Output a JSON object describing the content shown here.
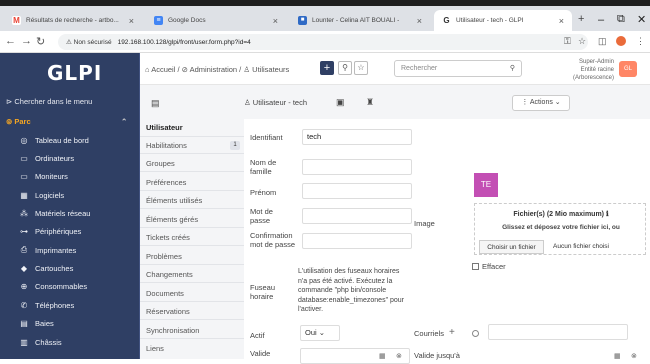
{
  "browser": {
    "tabs": [
      {
        "label": "Résultats de recherche - artbo...",
        "fav_color": "#ea4335",
        "fav_letter": "M"
      },
      {
        "label": "Google Docs",
        "fav_color": "#4285f4",
        "fav_letter": "≡"
      },
      {
        "label": "Lounter - Celina AIT BOUALI -",
        "fav_color": "#2f6ac5",
        "fav_letter": "■"
      },
      {
        "label": "Utilisateur - tech - GLPI",
        "fav_color": "#333",
        "fav_letter": "G"
      }
    ],
    "security": "Non sécurisé",
    "url": "192.168.100.128/glpi/front/user.form.php?id=4"
  },
  "sidebar": {
    "logo": "GLPI",
    "search": "Chercher dans le menu",
    "section": "Parc",
    "items": [
      {
        "label": "Tableau de bord",
        "icon": "dashboard-icon",
        "glyph": "◎"
      },
      {
        "label": "Ordinateurs",
        "icon": "computer-icon",
        "glyph": "▭"
      },
      {
        "label": "Moniteurs",
        "icon": "monitor-icon",
        "glyph": "▭"
      },
      {
        "label": "Logiciels",
        "icon": "software-icon",
        "glyph": "▦"
      },
      {
        "label": "Matériels réseau",
        "icon": "network-icon",
        "glyph": "⁂"
      },
      {
        "label": "Périphériques",
        "icon": "device-icon",
        "glyph": "⊶"
      },
      {
        "label": "Imprimantes",
        "icon": "printer-icon",
        "glyph": "⎙"
      },
      {
        "label": "Cartouches",
        "icon": "cartridge-icon",
        "glyph": "◆"
      },
      {
        "label": "Consommables",
        "icon": "consumable-icon",
        "glyph": "⊕"
      },
      {
        "label": "Téléphones",
        "icon": "phone-icon",
        "glyph": "✆"
      },
      {
        "label": "Baies",
        "icon": "rack-icon",
        "glyph": "▤"
      },
      {
        "label": "Châssis",
        "icon": "chassis-icon",
        "glyph": "▥"
      }
    ]
  },
  "header": {
    "breadcrumb": "⌂ Accueil / ⊘ Administration / ♙ Utilisateurs",
    "search_placeholder": "Rechercher",
    "user_name": "Super-Admin",
    "entity": "Entité racine (Arborescence)",
    "avatar": "GL"
  },
  "card": {
    "title": "♙ Utilisateur - tech",
    "actions": "⋮ Actions ⌄"
  },
  "vtabs": [
    "Utilisateur",
    "Habilitations",
    "Groupes",
    "Préférences",
    "Éléments utilisés",
    "Éléments gérés",
    "Tickets créés",
    "Problèmes",
    "Changements",
    "Documents",
    "Réservations",
    "Synchronisation",
    "Liens"
  ],
  "habilitations_count": "1",
  "form": {
    "identifiant_label": "Identifiant",
    "identifiant_value": "tech",
    "nom_label": "Nom de famille",
    "prenom_label": "Prénom",
    "mdp_label": "Mot de passe",
    "confirm_label": "Confirmation mot de passe",
    "fuseau_label": "Fuseau horaire",
    "tz_note": "L'utilisation des fuseaux horaires n'a pas été activé. Exécutez la commande \"php bin/console database:enable_timezones\" pour l'activer.",
    "actif_label": "Actif",
    "actif_value": "Oui",
    "valide_label": "Valide",
    "image_label": "Image",
    "avatar_initials": "TE",
    "upload_title": "Fichier(s) (2 Mio maximum) ℹ",
    "upload_hint": "Glissez et déposez votre fichier ici, ou",
    "choose_file": "Choisir un fichier",
    "no_file": "Aucun fichier choisi",
    "effacer": "Effacer",
    "courriels_label": "Courriels",
    "valide_jusqua": "Valide jusqu'à"
  }
}
